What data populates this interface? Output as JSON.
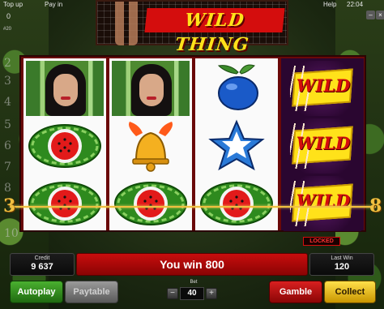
{
  "topbar": {
    "topup": "Top up",
    "payin": "Pay in",
    "help": "Help",
    "clock": "22:04",
    "counter": "0",
    "hash": "#20"
  },
  "logo": {
    "text": "WILD THING"
  },
  "reels": [
    {
      "symbols": [
        {
          "type": "lady",
          "icon": "lady-icon"
        },
        {
          "type": "watermelon",
          "icon": "watermelon-icon"
        },
        {
          "type": "watermelon",
          "icon": "watermelon-icon"
        }
      ]
    },
    {
      "symbols": [
        {
          "type": "lady",
          "icon": "lady-icon"
        },
        {
          "type": "bell",
          "icon": "bell-icon"
        },
        {
          "type": "watermelon",
          "icon": "watermelon-icon"
        }
      ]
    },
    {
      "symbols": [
        {
          "type": "plum",
          "icon": "plum-icon"
        },
        {
          "type": "star",
          "icon": "star-icon"
        },
        {
          "type": "watermelon",
          "icon": "watermelon-icon"
        }
      ]
    },
    {
      "symbols": [
        {
          "type": "wild",
          "label": "WILD",
          "icon": "wild-icon"
        },
        {
          "type": "wild",
          "label": "WILD",
          "icon": "wild-icon"
        },
        {
          "type": "wild",
          "label": "WILD",
          "icon": "wild-icon"
        }
      ]
    }
  ],
  "paylines": {
    "left_numbers": [
      "2",
      "3",
      "4",
      "5",
      "6",
      "7",
      "8",
      "10"
    ],
    "active_left": "3",
    "active_right": "8"
  },
  "locked_label": "LOCKED",
  "panel": {
    "credit_label": "Credit",
    "credit_value": "9 637",
    "message": "You win 800",
    "lastwin_label": "Last Win",
    "lastwin_value": "120"
  },
  "buttons": {
    "autoplay": "Autoplay",
    "paytable": "Paytable",
    "gamble": "Gamble",
    "collect": "Collect"
  },
  "bet": {
    "label": "Bet",
    "value": "40",
    "minus": "−",
    "plus": "+"
  },
  "colors": {
    "panel_red": "#c80d0d",
    "wild_yellow": "#ffe21a",
    "payline_gold": "#f0c040",
    "button_green": "#4ab030"
  }
}
